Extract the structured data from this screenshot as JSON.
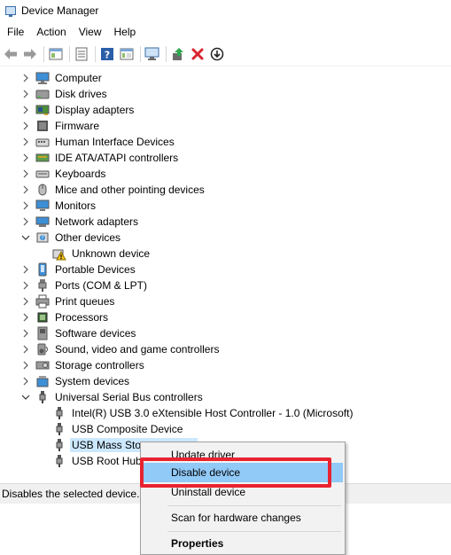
{
  "window": {
    "title": "Device Manager"
  },
  "menu": [
    "File",
    "Action",
    "View",
    "Help"
  ],
  "toolbar": {
    "icons": [
      "back-arrow-icon",
      "forward-arrow-icon",
      "show-hide-console-tree-icon",
      "properties-icon",
      "help-icon",
      "view-icon",
      "scan-hardware-icon",
      "update-driver-icon",
      "uninstall-icon",
      "disable-icon"
    ]
  },
  "tree": [
    {
      "label": "Computer",
      "expanded": false,
      "icon": "computer-icon"
    },
    {
      "label": "Disk drives",
      "expanded": false,
      "icon": "disk-drive-icon"
    },
    {
      "label": "Display adapters",
      "expanded": false,
      "icon": "display-adapter-icon"
    },
    {
      "label": "Firmware",
      "expanded": false,
      "icon": "firmware-icon"
    },
    {
      "label": "Human Interface Devices",
      "expanded": false,
      "icon": "hid-icon"
    },
    {
      "label": "IDE ATA/ATAPI controllers",
      "expanded": false,
      "icon": "ide-controller-icon"
    },
    {
      "label": "Keyboards",
      "expanded": false,
      "icon": "keyboard-icon"
    },
    {
      "label": "Mice and other pointing devices",
      "expanded": false,
      "icon": "mouse-icon"
    },
    {
      "label": "Monitors",
      "expanded": false,
      "icon": "monitor-icon"
    },
    {
      "label": "Network adapters",
      "expanded": false,
      "icon": "network-adapter-icon"
    },
    {
      "label": "Other devices",
      "expanded": true,
      "icon": "other-devices-icon"
    },
    {
      "label": "Unknown device",
      "child": true,
      "icon": "unknown-device-warning-icon"
    },
    {
      "label": "Portable Devices",
      "expanded": false,
      "icon": "portable-device-icon"
    },
    {
      "label": "Ports (COM & LPT)",
      "expanded": false,
      "icon": "port-icon"
    },
    {
      "label": "Print queues",
      "expanded": false,
      "icon": "printer-icon"
    },
    {
      "label": "Processors",
      "expanded": false,
      "icon": "processor-icon"
    },
    {
      "label": "Software devices",
      "expanded": false,
      "icon": "software-device-icon"
    },
    {
      "label": "Sound, video and game controllers",
      "expanded": false,
      "icon": "sound-icon"
    },
    {
      "label": "Storage controllers",
      "expanded": false,
      "icon": "storage-controller-icon"
    },
    {
      "label": "System devices",
      "expanded": false,
      "icon": "system-device-icon"
    },
    {
      "label": "Universal Serial Bus controllers",
      "expanded": true,
      "icon": "usb-icon"
    },
    {
      "label": "Intel(R) USB 3.0 eXtensible Host Controller - 1.0 (Microsoft)",
      "child": true,
      "icon": "usb-icon"
    },
    {
      "label": "USB Composite Device",
      "child": true,
      "icon": "usb-icon"
    },
    {
      "label": "USB Mass Stor",
      "child": true,
      "selected": true,
      "icon": "usb-icon"
    },
    {
      "label": "USB Root Hub",
      "child": true,
      "icon": "usb-icon"
    }
  ],
  "status": {
    "text": "Disables the selected device."
  },
  "context_menu": {
    "items": [
      {
        "label": "Update driver"
      },
      {
        "label": "Disable device",
        "hover": true
      },
      {
        "label": "Uninstall device"
      },
      {
        "label": "Scan for hardware changes"
      },
      {
        "label": "Properties",
        "bold": true
      }
    ]
  },
  "colors": {
    "selection": "#cce8ff",
    "menu_hover": "#91c9f7",
    "highlight_box": "#e8232f",
    "warning": "#f5c518"
  }
}
